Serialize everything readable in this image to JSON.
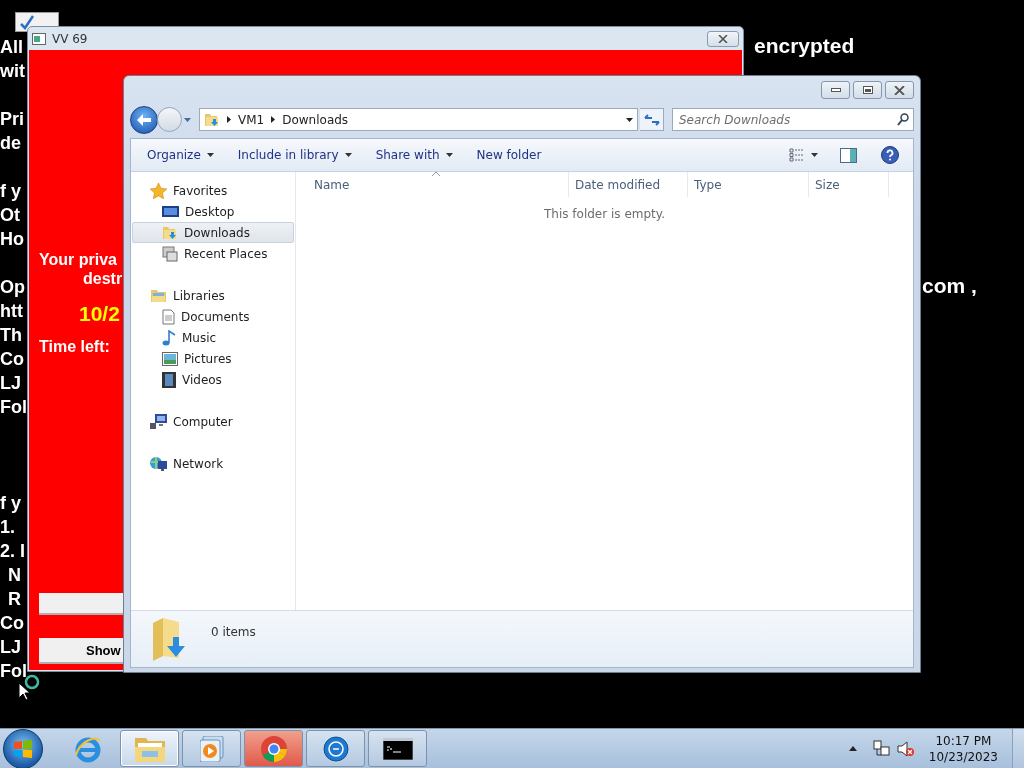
{
  "desktop": {
    "text_paragraphs": [
      [
        {
          "text": "All",
          "kind": "line"
        },
        {
          "text": "wit",
          "kind": "line"
        }
      ],
      [
        {
          "text": "Pri",
          "kind": "line"
        },
        {
          "text": "de",
          "kind": "line"
        }
      ],
      [
        {
          "text": "f y",
          "kind": "line"
        },
        {
          "text": "Ot",
          "kind": "line"
        },
        {
          "text": "Ho",
          "kind": "line"
        }
      ],
      [
        {
          "text": "Op",
          "kind": "line"
        },
        {
          "text": "htt",
          "kind": "line"
        },
        {
          "text": "Th",
          "kind": "line"
        },
        {
          "text": "Co",
          "kind": "line"
        },
        {
          "text": "LJ",
          "kind": "line"
        },
        {
          "text": "Fol",
          "kind": "line"
        }
      ],
      [
        {
          "text": "f y",
          "kind": "line"
        },
        {
          "text": "1.",
          "kind": "line"
        },
        {
          "text": "2. I",
          "kind": "line"
        },
        {
          "text": "N",
          "kind": "subline"
        },
        {
          "text": "R",
          "kind": "subline"
        },
        {
          "text": "Co",
          "kind": "line"
        },
        {
          "text": "LJ",
          "kind": "line"
        },
        {
          "text": "Fol",
          "kind": "line"
        }
      ]
    ],
    "text_right_top": "encrypted",
    "text_right_middle": "com ,"
  },
  "ransom_window": {
    "title": "VV 69",
    "message_lines": [
      "Your priva",
      "destr"
    ],
    "deadline": "10/2",
    "time_left_label": "Time left:",
    "buttons": [
      {
        "kind": "blank"
      },
      {
        "kind": "text",
        "label": "Show"
      }
    ]
  },
  "explorer": {
    "breadcrumbs": [
      "VM1",
      "Downloads"
    ],
    "search": {
      "placeholder": "Search Downloads"
    },
    "commands": [
      {
        "label": "Organize",
        "dropdown": true
      },
      {
        "label": "Include in library",
        "dropdown": true
      },
      {
        "label": "Share with",
        "dropdown": true
      },
      {
        "label": "New folder",
        "dropdown": false
      }
    ],
    "sidebar": [
      {
        "label": "Favorites",
        "selected": false,
        "children": [
          {
            "label": "Desktop",
            "selected": false
          },
          {
            "label": "Downloads",
            "selected": true
          },
          {
            "label": "Recent Places",
            "selected": false
          }
        ]
      },
      {
        "label": "Libraries",
        "selected": false,
        "children": [
          {
            "label": "Documents",
            "selected": false
          },
          {
            "label": "Music",
            "selected": false
          },
          {
            "label": "Pictures",
            "selected": false
          },
          {
            "label": "Videos",
            "selected": false
          }
        ]
      },
      {
        "label": "Computer",
        "selected": false
      },
      {
        "label": "Network",
        "selected": false
      }
    ],
    "columns": [
      "Name",
      "Date modified",
      "Type",
      "Size"
    ],
    "empty_message": "This folder is empty.",
    "status": "0 items"
  },
  "taskbar": {
    "apps": [
      {
        "running": false,
        "selected": false,
        "flashing": false
      },
      {
        "running": true,
        "selected": true,
        "flashing": false
      },
      {
        "running": true,
        "selected": false,
        "flashing": false
      },
      {
        "running": true,
        "selected": false,
        "flashing": true
      },
      {
        "running": true,
        "selected": false,
        "flashing": false
      },
      {
        "running": true,
        "selected": false,
        "flashing": false
      }
    ],
    "time": "10:17 PM",
    "date": "10/23/2023"
  }
}
